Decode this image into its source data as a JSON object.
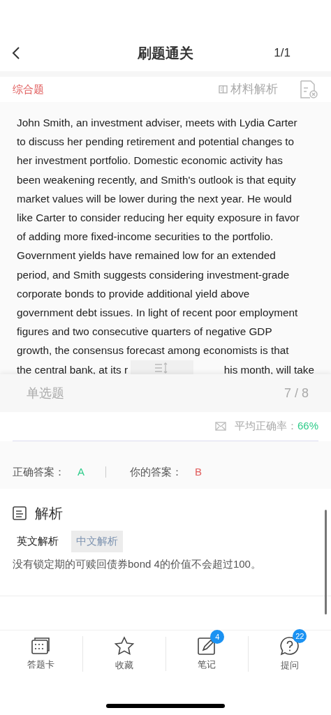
{
  "header": {
    "title": "刷题通关",
    "page": "1/1"
  },
  "question_bar": {
    "type": "综合题",
    "material": "材料解析"
  },
  "passage": {
    "text": "John Smith, an investment adviser, meets with Lydia Carter to discuss her pending retirement and potential changes to her investment portfolio. Domestic economic activity has been weakening recently, and Smith's outlook is that equity market values will be lower during the next year. He would like Carter to consider reducing her equity exposure in favor of adding more fixed-income securities to the portfolio. Government yields have remained low for an extended period, and Smith suggests considering investment-grade corporate bonds to provide additional yield above government debt issues. In light of recent poor employment figures and two consecutive quarters of negative GDP growth, the consensus forecast among economists is that",
    "cut_line_left": "the central bank, at its r",
    "cut_line_right": "his month, will take"
  },
  "sub_question": {
    "type": "单选题",
    "progress": "7 / 8"
  },
  "accuracy": {
    "label": "平均正确率：",
    "value": "66%"
  },
  "answers": {
    "correct_label": "正确答案：",
    "correct": "A",
    "yours_label": "你的答案：",
    "yours": "B"
  },
  "analysis": {
    "title": "解析",
    "tabs": [
      {
        "label": "英文解析",
        "selected": false
      },
      {
        "label": "中文解析",
        "selected": true
      }
    ],
    "text": "没有锁定期的可赎回债券bond 4的价值不会超过100。"
  },
  "bottom_nav": [
    {
      "kind": "card",
      "label": "答题卡"
    },
    {
      "kind": "star",
      "label": "收藏"
    },
    {
      "kind": "note",
      "label": "笔记",
      "badge": "4"
    },
    {
      "kind": "ask",
      "label": "提问",
      "badge": "22"
    }
  ]
}
